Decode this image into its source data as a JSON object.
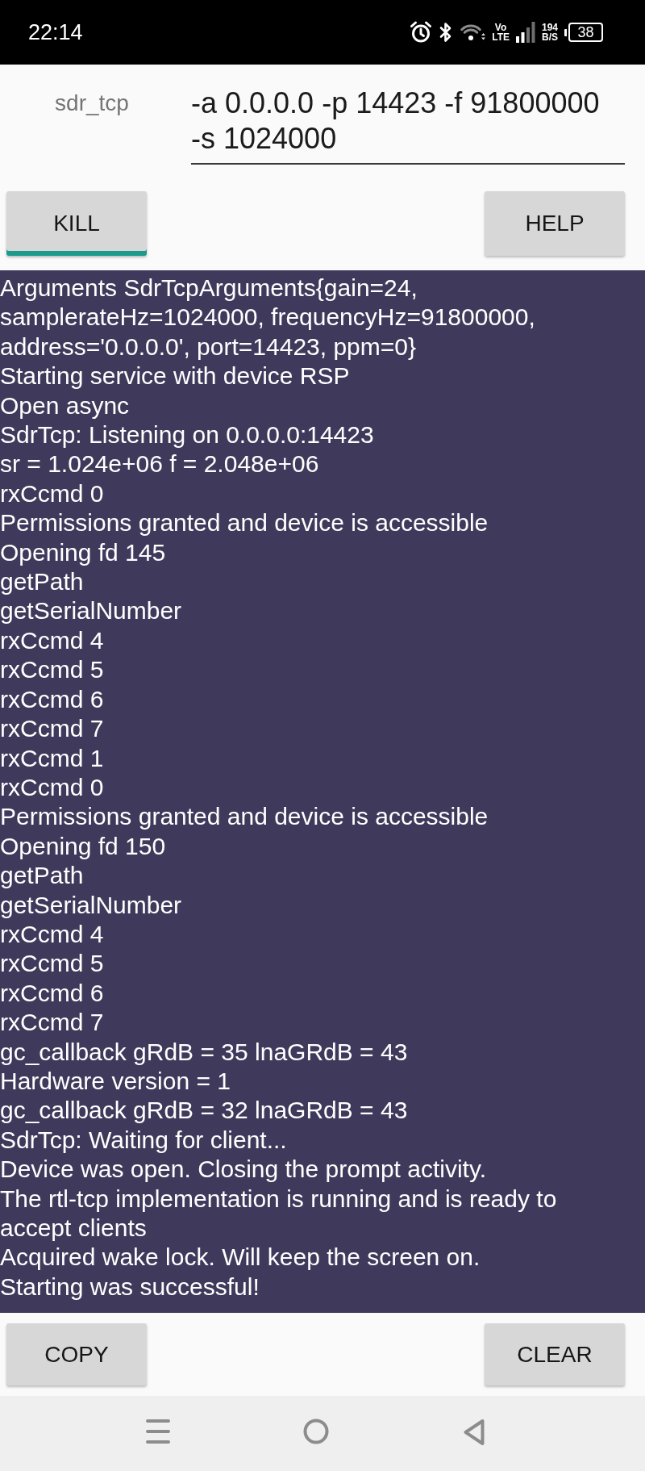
{
  "status_bar": {
    "time": "22:14",
    "network_type": {
      "top": "Vo",
      "bottom": "LTE"
    },
    "data_rate": {
      "value": "194",
      "unit": "B/S"
    },
    "battery": "38"
  },
  "command": {
    "label": "sdr_tcp",
    "value": "-a 0.0.0.0 -p 14423 -f 91800000 -s 1024000"
  },
  "top_buttons": [
    {
      "label": "KILL",
      "kind": "toggle",
      "on": true
    },
    {
      "label": "HELP",
      "kind": "button"
    }
  ],
  "log": [
    "Arguments SdrTcpArguments{gain=24,",
    "samplerateHz=1024000, frequencyHz=91800000,",
    "address='0.0.0.0', port=14423, ppm=0}",
    "Starting service with device RSP",
    "Open async",
    "SdrTcp: Listening on 0.0.0.0:14423",
    "sr = 1.024e+06 f = 2.048e+06",
    "rxCcmd 0",
    "Permissions granted and device is accessible",
    "Opening fd 145",
    "getPath",
    "getSerialNumber",
    "rxCcmd 4",
    "rxCcmd 5",
    "rxCcmd 6",
    "rxCcmd 7",
    "rxCcmd 1",
    "rxCcmd 0",
    "Permissions granted and device is accessible",
    "Opening fd 150",
    "getPath",
    "getSerialNumber",
    "rxCcmd 4",
    "rxCcmd 5",
    "rxCcmd 6",
    "rxCcmd 7",
    "gc_callback gRdB = 35 lnaGRdB = 43",
    "Hardware version = 1",
    "gc_callback gRdB = 32 lnaGRdB = 43",
    "SdrTcp: Waiting for client...",
    "Device was open. Closing the prompt activity.",
    "The rtl-tcp implementation is running and is ready to",
    "accept clients",
    "Acquired wake lock. Will keep the screen on.",
    "Starting was successful!"
  ],
  "bottom_buttons": [
    {
      "label": "COPY"
    },
    {
      "label": "CLEAR"
    }
  ]
}
